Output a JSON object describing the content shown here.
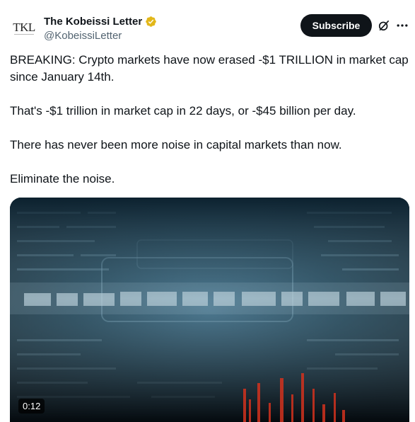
{
  "author": {
    "display_name": "The Kobeissi Letter",
    "handle": "@KobeissiLetter",
    "avatar_text": "TKL",
    "verified_icon": "gold-verified-badge-icon"
  },
  "actions": {
    "subscribe_label": "Subscribe",
    "grok_icon": "grok-icon",
    "more_icon": "more-icon"
  },
  "tweet": {
    "paragraphs": [
      "BREAKING: Crypto markets have now erased -$1 TRILLION in market cap since January 14th.",
      "That's -$1 trillion in market cap in 22 days, or -$45 billion per day.",
      "There has never been more noise in capital markets than now.",
      "Eliminate the noise."
    ]
  },
  "media": {
    "type": "video",
    "duration": "0:12"
  },
  "colors": {
    "text": "#0f1419",
    "secondary": "#536471",
    "button_bg": "#0f1419",
    "verified_gold": "#e2b719"
  }
}
